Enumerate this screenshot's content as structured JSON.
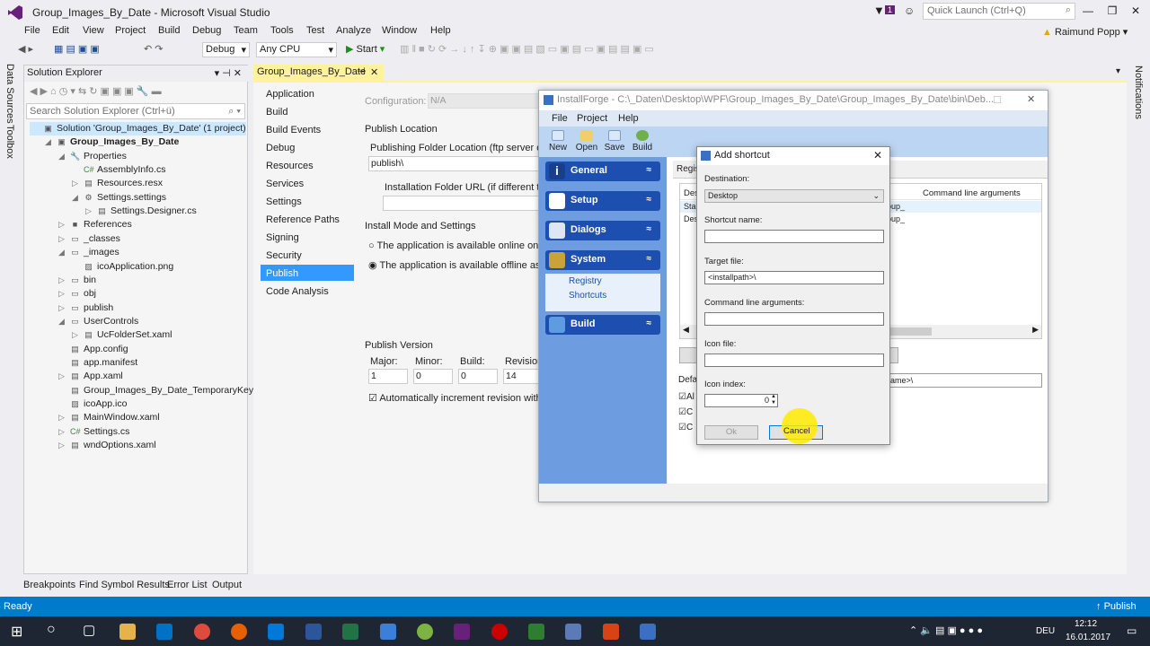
{
  "window": {
    "title": "Group_Images_By_Date - Microsoft Visual Studio",
    "quick_launch": "Quick Launch (Ctrl+Q)",
    "notif_count": "1",
    "user": "Raimund Popp"
  },
  "menu": [
    "File",
    "Edit",
    "View",
    "Project",
    "Build",
    "Debug",
    "Team",
    "Tools",
    "Test",
    "Analyze",
    "Window",
    "Help"
  ],
  "toolbar": {
    "config": "Debug",
    "platform": "Any CPU",
    "start": "Start"
  },
  "left_strip": [
    "Data Sources",
    "Toolbox"
  ],
  "right_strip": [
    "Notifications"
  ],
  "solution_explorer": {
    "title": "Solution Explorer",
    "search_placeholder": "Search Solution Explorer (Ctrl+ü)",
    "items": [
      {
        "label": "Solution 'Group_Images_By_Date' (1 project)",
        "indent": 0,
        "exp": "",
        "ic": "▣",
        "sel": true
      },
      {
        "label": "Group_Images_By_Date",
        "indent": 1,
        "exp": "◢",
        "ic": "▣",
        "bold": true
      },
      {
        "label": "Properties",
        "indent": 2,
        "exp": "◢",
        "ic": "🔧"
      },
      {
        "label": "AssemblyInfo.cs",
        "indent": 3,
        "exp": "",
        "ic": "C#"
      },
      {
        "label": "Resources.resx",
        "indent": 3,
        "exp": "▷",
        "ic": "▤"
      },
      {
        "label": "Settings.settings",
        "indent": 3,
        "exp": "◢",
        "ic": "⚙"
      },
      {
        "label": "Settings.Designer.cs",
        "indent": 4,
        "exp": "▷",
        "ic": "▤"
      },
      {
        "label": "References",
        "indent": 2,
        "exp": "▷",
        "ic": "■"
      },
      {
        "label": "_classes",
        "indent": 2,
        "exp": "▷",
        "ic": "▭"
      },
      {
        "label": "_images",
        "indent": 2,
        "exp": "◢",
        "ic": "▭"
      },
      {
        "label": "icoApplication.png",
        "indent": 3,
        "exp": "",
        "ic": "▨"
      },
      {
        "label": "bin",
        "indent": 2,
        "exp": "▷",
        "ic": "▭"
      },
      {
        "label": "obj",
        "indent": 2,
        "exp": "▷",
        "ic": "▭"
      },
      {
        "label": "publish",
        "indent": 2,
        "exp": "▷",
        "ic": "▭"
      },
      {
        "label": "UserControls",
        "indent": 2,
        "exp": "◢",
        "ic": "▭"
      },
      {
        "label": "UcFolderSet.xaml",
        "indent": 3,
        "exp": "▷",
        "ic": "▤"
      },
      {
        "label": "App.config",
        "indent": 2,
        "exp": "",
        "ic": "▤"
      },
      {
        "label": "app.manifest",
        "indent": 2,
        "exp": "",
        "ic": "▤"
      },
      {
        "label": "App.xaml",
        "indent": 2,
        "exp": "▷",
        "ic": "▤"
      },
      {
        "label": "Group_Images_By_Date_TemporaryKey.pfx",
        "indent": 2,
        "exp": "",
        "ic": "▤"
      },
      {
        "label": "icoApp.ico",
        "indent": 2,
        "exp": "",
        "ic": "▨"
      },
      {
        "label": "MainWindow.xaml",
        "indent": 2,
        "exp": "▷",
        "ic": "▤"
      },
      {
        "label": "Settings.cs",
        "indent": 2,
        "exp": "▷",
        "ic": "C#"
      },
      {
        "label": "wndOptions.xaml",
        "indent": 2,
        "exp": "▷",
        "ic": "▤"
      }
    ]
  },
  "bottom_tabs": [
    "Breakpoints",
    "Find Symbol Results",
    "Error List",
    "Output"
  ],
  "doc_tab": "Group_Images_By_Date",
  "project_nav": [
    "Application",
    "Build",
    "Build Events",
    "Debug",
    "Resources",
    "Services",
    "Settings",
    "Reference Paths",
    "Signing",
    "Security",
    "Publish",
    "Code Analysis"
  ],
  "publish": {
    "configuration_label": "Configuration:",
    "configuration_value": "N/A",
    "publish_location": "Publish Location",
    "folder_label": "Publishing Folder Location (ftp server or fil",
    "folder_value": "publish\\",
    "install_url_label": "Installation Folder URL (if different thar",
    "install_mode": "Install Mode and Settings",
    "radio_online": "The application is available online only",
    "radio_offline": "The application is available offline as w",
    "publish_version": "Publish Version",
    "major": "Major:",
    "minor": "Minor:",
    "build": "Build:",
    "revision": "Revision",
    "major_v": "1",
    "minor_v": "0",
    "build_v": "0",
    "revision_v": "14",
    "auto_increment": "Automatically increment revision with e"
  },
  "installforge": {
    "title": "InstallForge - C:\\_Daten\\Desktop\\WPF\\Group_Images_By_Date\\Group_Images_By_Date\\bin\\Deb...",
    "menu": [
      "File",
      "Project",
      "Help"
    ],
    "tools": [
      "New",
      "Open",
      "Save",
      "Build"
    ],
    "groups": [
      "General",
      "Setup",
      "Dialogs",
      "System",
      "Build"
    ],
    "sub_items": [
      "Registry",
      "Shortcuts"
    ],
    "right_header": "Regist",
    "col_header": "Command line arguments",
    "rows": [
      "Des",
      "Sta",
      "Des"
    ],
    "row_cells": [
      "oup_",
      "oup_"
    ],
    "defa": "Defa",
    "name_field": "ame>\\",
    "checks": [
      "Al",
      "C",
      "C"
    ]
  },
  "dialog": {
    "title": "Add shortcut",
    "destination_label": "Destination:",
    "destination_value": "Desktop",
    "shortcut_name_label": "Shortcut name:",
    "target_file_label": "Target file:",
    "target_file_value": "<installpath>\\",
    "cmd_args_label": "Command line arguments:",
    "icon_file_label": "Icon file:",
    "icon_index_label": "Icon index:",
    "icon_index_value": "0",
    "ok": "Ok",
    "cancel": "Cancel"
  },
  "status": {
    "left": "Ready",
    "right": "Publish"
  },
  "clock": {
    "time": "12:12",
    "date": "16.01.2017",
    "lang": "DEU"
  }
}
